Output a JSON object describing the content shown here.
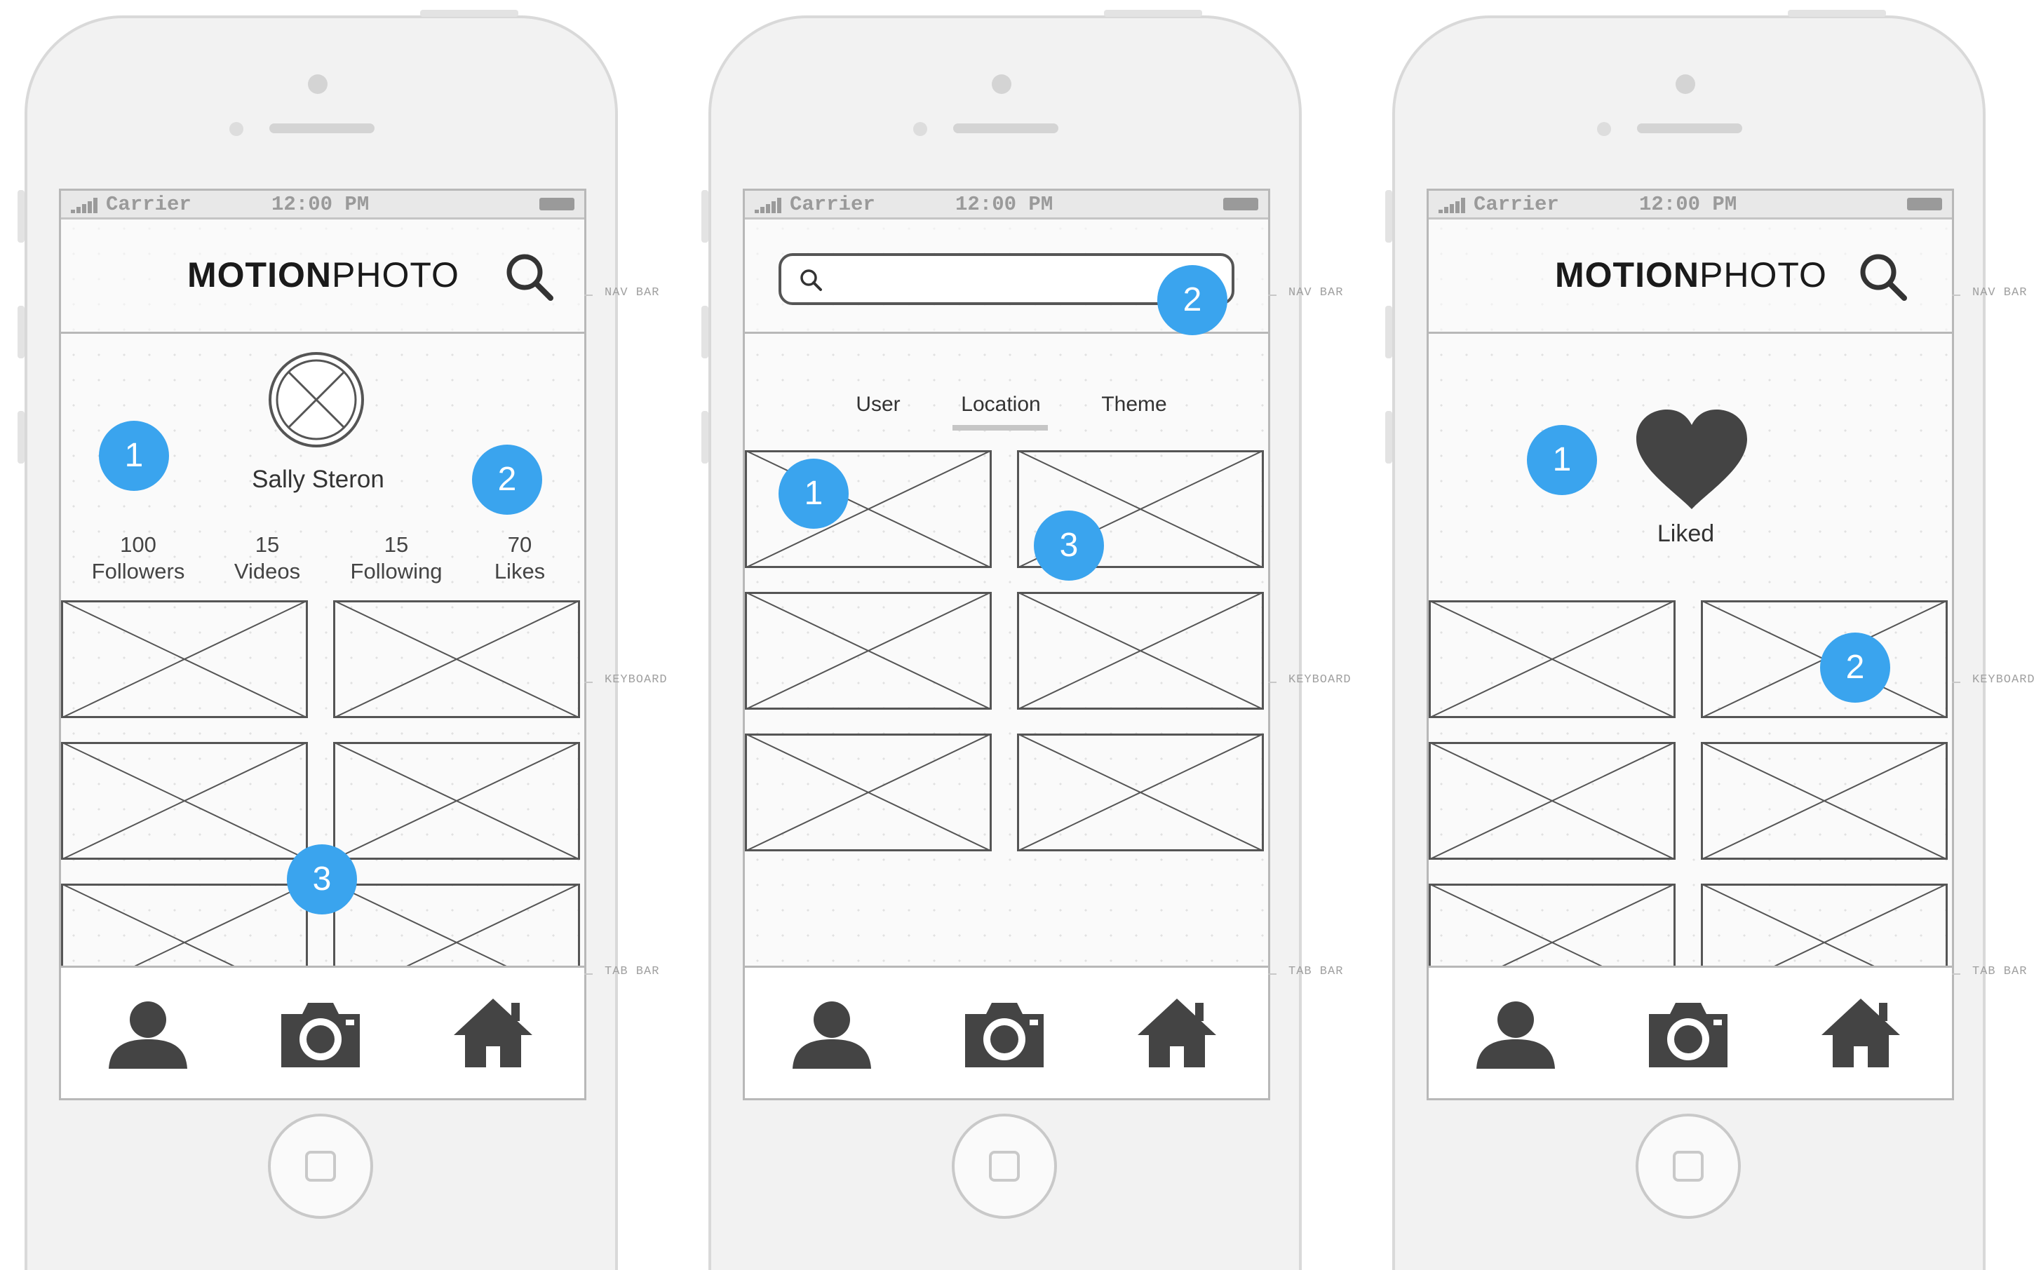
{
  "status_bar": {
    "carrier": "Carrier",
    "time": "12:00 PM"
  },
  "annotations": {
    "nav_bar": "NAV BAR",
    "keyboard": "KEYBOARD",
    "tab_bar": "TAB BAR"
  },
  "screens": [
    {
      "brand_bold": "MOTION",
      "brand_light": "PHOTO",
      "profile_name": "Sally Steron",
      "stats": [
        {
          "value": "100",
          "label": "Followers"
        },
        {
          "value": "15",
          "label": "Videos"
        },
        {
          "value": "15",
          "label": "Following"
        },
        {
          "value": "70",
          "label": "Likes"
        }
      ],
      "callouts": [
        "1",
        "2",
        "3"
      ]
    },
    {
      "tabs": [
        "User",
        "Location",
        "Theme"
      ],
      "active_tab": "Location",
      "callouts": [
        "1",
        "2",
        "3"
      ]
    },
    {
      "brand_bold": "MOTION",
      "brand_light": "PHOTO",
      "liked_label": "Liked",
      "callouts": [
        "1",
        "2"
      ]
    }
  ],
  "icons": {
    "nav": "search-icon",
    "tabs": [
      "user-icon",
      "camera-icon",
      "home-icon"
    ],
    "placeholder": "image-placeholder-icon",
    "liked": "heart-icon"
  },
  "colors": {
    "callout": "#3aa4ee",
    "icon_dark": "#444444",
    "wire": "#555555"
  }
}
